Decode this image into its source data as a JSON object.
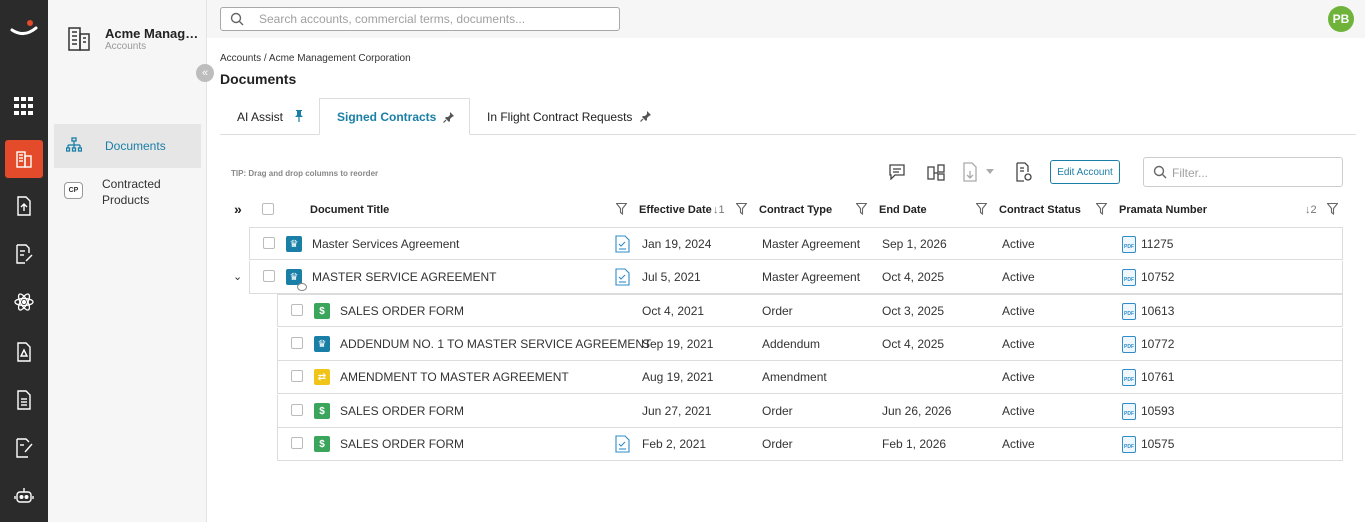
{
  "search": {
    "placeholder": "Search accounts, commercial terms, documents..."
  },
  "user": {
    "initials": "PB"
  },
  "account": {
    "name": "Acme Manage...",
    "subtitle": "Accounts"
  },
  "sidebar": {
    "items": [
      {
        "label": "Documents",
        "active": true
      },
      {
        "badge": "CP",
        "label": "Contracted Products"
      }
    ]
  },
  "breadcrumb": "Accounts / Acme Management Corporation",
  "page_title": "Documents",
  "tabs": [
    {
      "label": "AI Assist",
      "active": false
    },
    {
      "label": "Signed Contracts",
      "active": true
    },
    {
      "label": "In Flight Contract Requests",
      "active": false
    }
  ],
  "tip": "TIP: Drag and drop columns to reorder",
  "toolbar": {
    "edit_account": "Edit Account",
    "filter_placeholder": "Filter..."
  },
  "columns": {
    "title": "Document Title",
    "effective": "Effective Date",
    "effective_sort": "↓1",
    "type": "Contract Type",
    "end": "End Date",
    "status": "Contract Status",
    "number": "Pramata Number",
    "number_sort": "↓2"
  },
  "rows": [
    {
      "title": "Master Services Agreement",
      "icon": "crown",
      "effective": "Jan 19, 2024",
      "type": "Master Agreement",
      "end": "Sep 1, 2026",
      "status": "Active",
      "number": "11275"
    },
    {
      "title": "MASTER SERVICE AGREEMENT",
      "icon": "crown",
      "effective": "Jul 5, 2021",
      "type": "Master Agreement",
      "end": "Oct 4, 2025",
      "status": "Active",
      "number": "10752"
    },
    {
      "title": "SALES ORDER FORM",
      "icon": "dollar",
      "effective": "Oct 4, 2021",
      "type": "Order",
      "end": "Oct 3, 2025",
      "status": "Active",
      "number": "10613"
    },
    {
      "title": "ADDENDUM NO. 1 TO MASTER SERVICE AGREEMENT",
      "icon": "crown",
      "effective": "Sep 19, 2021",
      "type": "Addendum",
      "end": "Oct 4, 2025",
      "status": "Active",
      "number": "10772"
    },
    {
      "title": "AMENDMENT TO MASTER AGREEMENT",
      "icon": "shuffle",
      "effective": "Aug 19, 2021",
      "type": "Amendment",
      "end": "",
      "status": "Active",
      "number": "10761"
    },
    {
      "title": "SALES ORDER FORM",
      "icon": "dollar",
      "effective": "Jun 27, 2021",
      "type": "Order",
      "end": "Jun 26, 2026",
      "status": "Active",
      "number": "10593"
    },
    {
      "title": "SALES ORDER FORM",
      "icon": "dollar",
      "effective": "Feb 2, 2021",
      "type": "Order",
      "end": "Feb 1, 2026",
      "status": "Active",
      "number": "10575"
    }
  ],
  "colors": {
    "accent": "#1a7fa6",
    "rail": "#2b2b2b",
    "rail_active": "#e34b2a",
    "avatar": "#6fb33b"
  }
}
